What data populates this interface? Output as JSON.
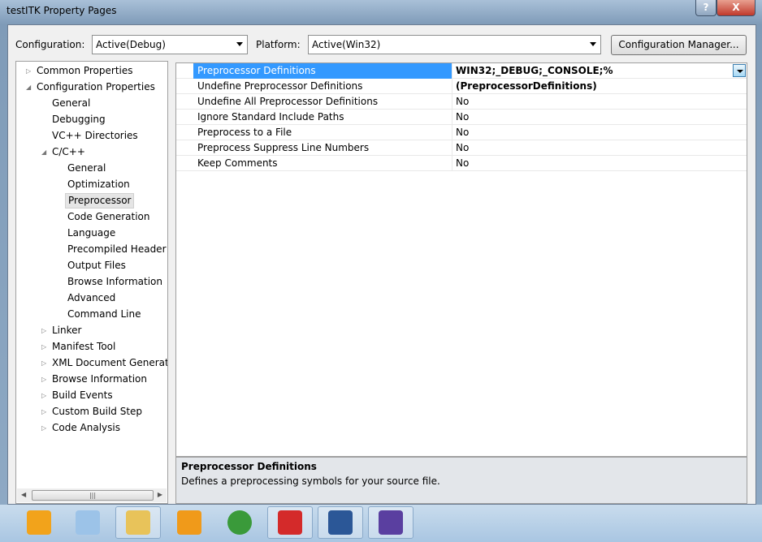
{
  "window": {
    "title": "testITK Property Pages",
    "help": "?",
    "close": "X"
  },
  "toolbar": {
    "configuration_label": "Configuration:",
    "configuration_value": "Active(Debug)",
    "platform_label": "Platform:",
    "platform_value": "Active(Win32)",
    "config_manager": "Configuration Manager..."
  },
  "tree": [
    {
      "label": "Common Properties",
      "level": 0,
      "twisty": "collapsed"
    },
    {
      "label": "Configuration Properties",
      "level": 0,
      "twisty": "expanded"
    },
    {
      "label": "General",
      "level": 1
    },
    {
      "label": "Debugging",
      "level": 1
    },
    {
      "label": "VC++ Directories",
      "level": 1
    },
    {
      "label": "C/C++",
      "level": 1,
      "twisty": "expanded"
    },
    {
      "label": "General",
      "level": 2
    },
    {
      "label": "Optimization",
      "level": 2
    },
    {
      "label": "Preprocessor",
      "level": 2,
      "selected": true
    },
    {
      "label": "Code Generation",
      "level": 2
    },
    {
      "label": "Language",
      "level": 2
    },
    {
      "label": "Precompiled Header",
      "level": 2
    },
    {
      "label": "Output Files",
      "level": 2
    },
    {
      "label": "Browse Information",
      "level": 2
    },
    {
      "label": "Advanced",
      "level": 2
    },
    {
      "label": "Command Line",
      "level": 2
    },
    {
      "label": "Linker",
      "level": 1,
      "twisty": "collapsed"
    },
    {
      "label": "Manifest Tool",
      "level": 1,
      "twisty": "collapsed"
    },
    {
      "label": "XML Document Generat",
      "level": 1,
      "twisty": "collapsed"
    },
    {
      "label": "Browse Information",
      "level": 1,
      "twisty": "collapsed"
    },
    {
      "label": "Build Events",
      "level": 1,
      "twisty": "collapsed"
    },
    {
      "label": "Custom Build Step",
      "level": 1,
      "twisty": "collapsed"
    },
    {
      "label": "Code Analysis",
      "level": 1,
      "twisty": "collapsed"
    }
  ],
  "properties": [
    {
      "name": "Preprocessor Definitions",
      "value": "WIN32;_DEBUG;_CONSOLE;%(PreprocessorDefinitions)",
      "selected": true
    },
    {
      "name": "Undefine Preprocessor Definitions",
      "value": ""
    },
    {
      "name": "Undefine All Preprocessor Definitions",
      "value": "No"
    },
    {
      "name": "Ignore Standard Include Paths",
      "value": "No"
    },
    {
      "name": "Preprocess to a File",
      "value": "No"
    },
    {
      "name": "Preprocess Suppress Line Numbers",
      "value": "No"
    },
    {
      "name": "Keep Comments",
      "value": "No"
    }
  ],
  "description": {
    "title": "Preprocessor Definitions",
    "text": "Defines a preprocessing symbols for your source file."
  },
  "taskbar": [
    {
      "icon": "outlook-icon",
      "color": "#f2a31b"
    },
    {
      "icon": "search-document-icon",
      "color": "#9cc3e8"
    },
    {
      "icon": "file-explorer-icon",
      "color": "#e8c35a",
      "active": true
    },
    {
      "icon": "vmware-icon",
      "color": "#f09a1a"
    },
    {
      "icon": "chrome-icon",
      "color": "#3a9a3a"
    },
    {
      "icon": "xmind-icon",
      "color": "#d42a2a",
      "active": true
    },
    {
      "icon": "word-icon",
      "color": "#2b5797",
      "active": true
    },
    {
      "icon": "visual-studio-icon",
      "color": "#5a3fa0",
      "active": true
    }
  ]
}
